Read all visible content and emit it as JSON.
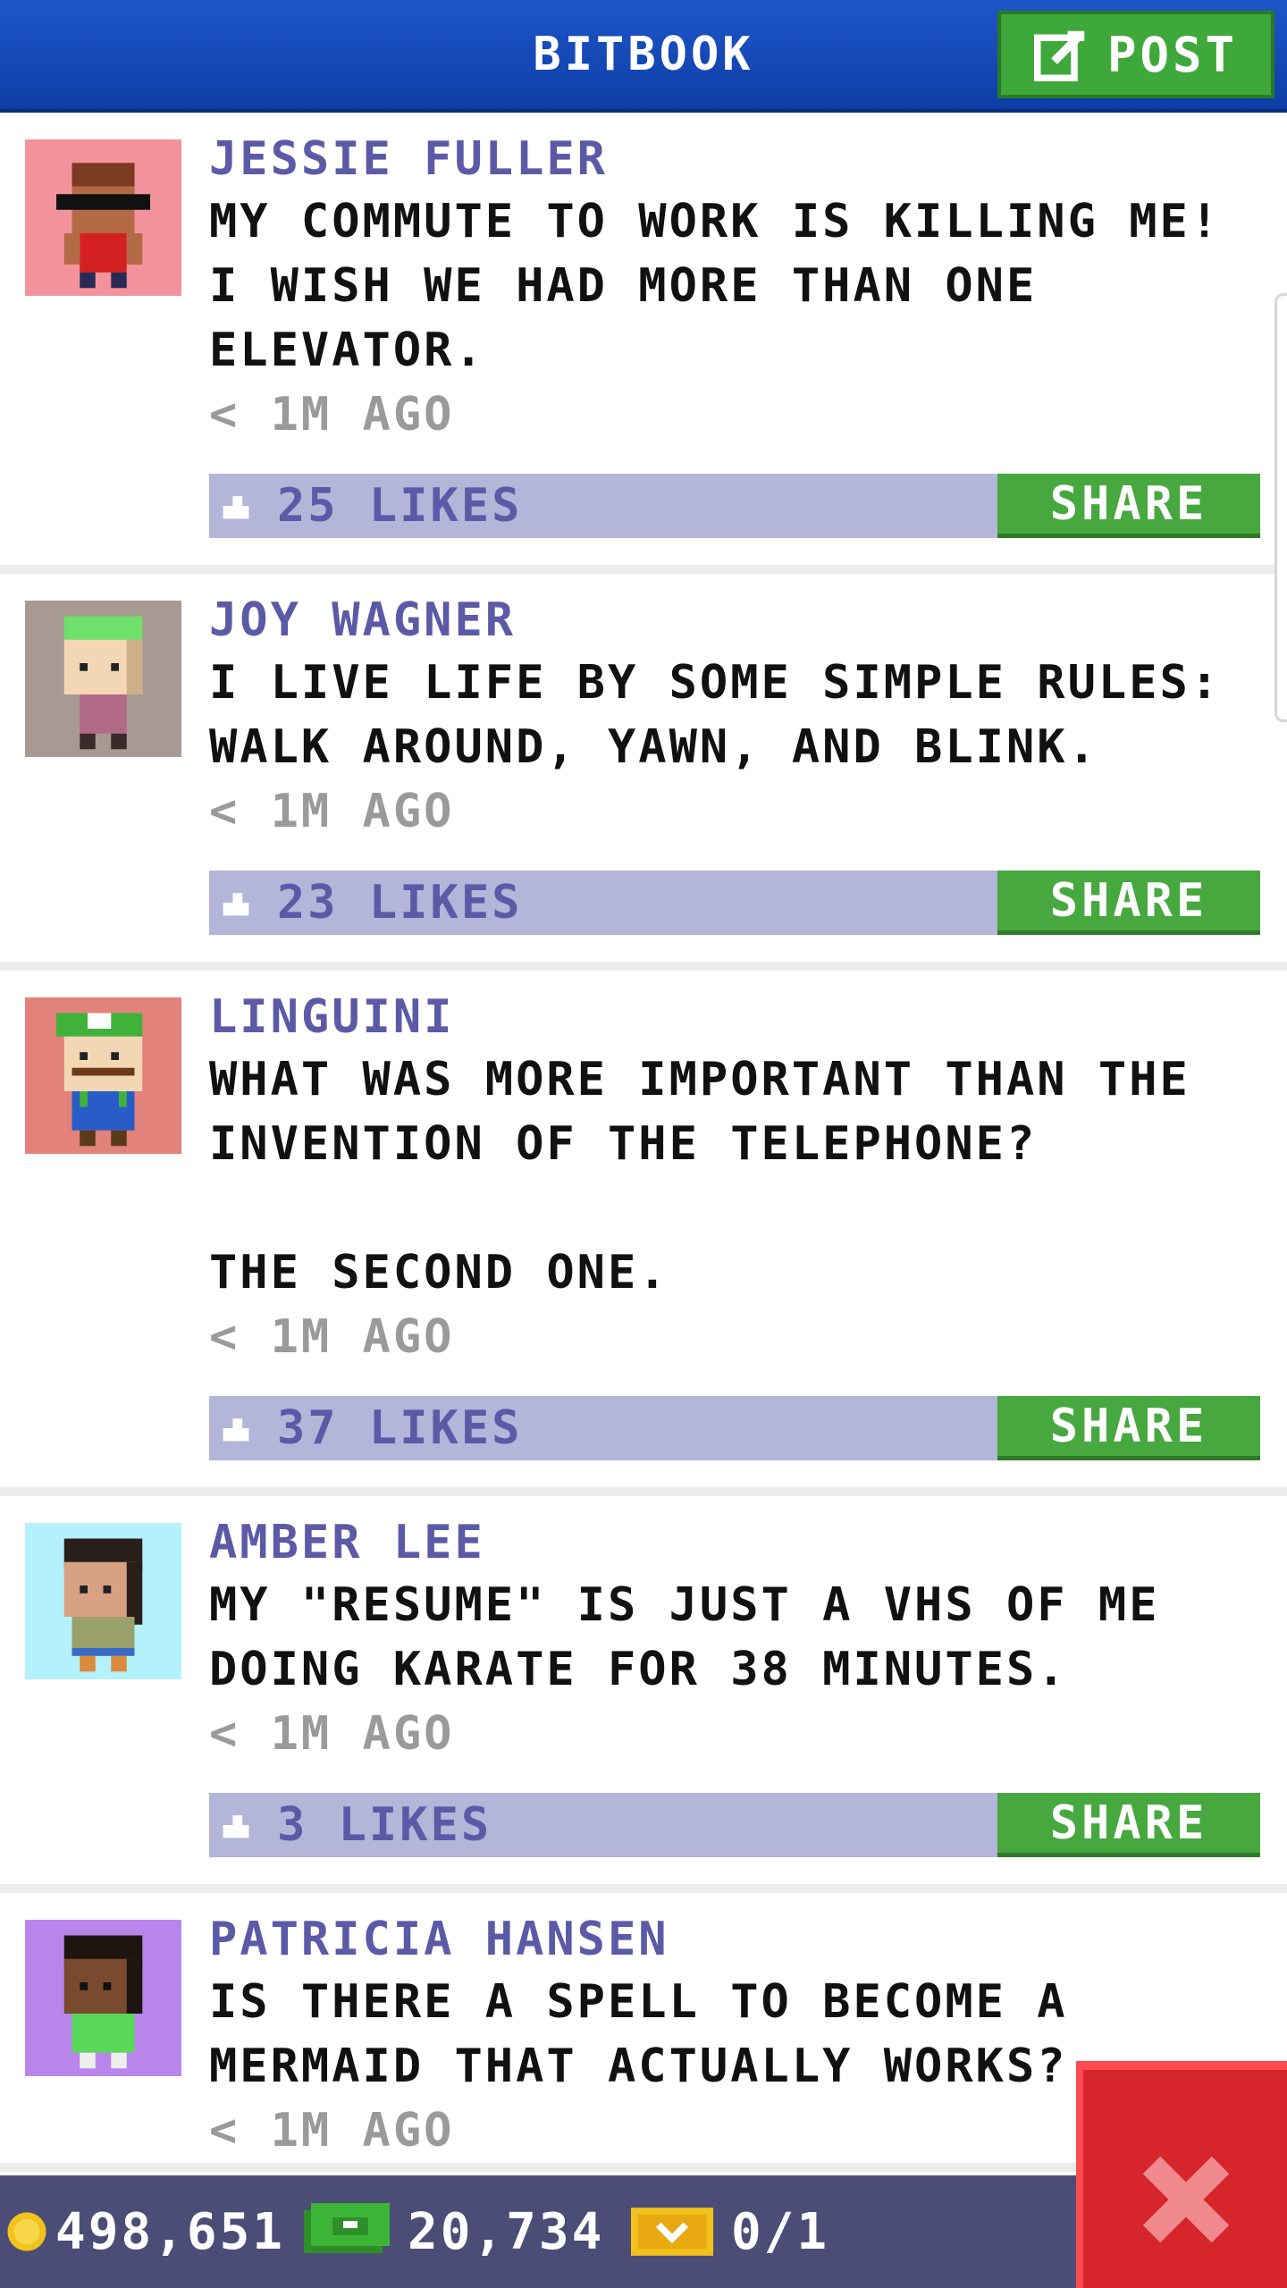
{
  "header": {
    "title": "BITBOOK",
    "post_label": "POST"
  },
  "posts": [
    {
      "author": "JESSIE FULLER",
      "text": "MY COMMUTE TO WORK IS KILLING ME! I WISH WE HAD MORE THAN ONE ELEVATOR.",
      "time": "< 1M AGO",
      "likes": "25 LIKES",
      "share": "SHARE",
      "avatar_bg": "#f2939b"
    },
    {
      "author": "JOY WAGNER",
      "text": "I LIVE LIFE BY SOME SIMPLE RULES: WALK AROUND, YAWN, AND BLINK.",
      "time": "< 1M AGO",
      "likes": "23 LIKES",
      "share": "SHARE",
      "avatar_bg": "#a89a92"
    },
    {
      "author": "LINGUINI",
      "text": "WHAT WAS MORE IMPORTANT THAN THE INVENTION OF THE TELEPHONE?\n\nTHE SECOND ONE.",
      "time": "< 1M AGO",
      "likes": "37 LIKES",
      "share": "SHARE",
      "avatar_bg": "#e2827b"
    },
    {
      "author": "AMBER LEE",
      "text": "MY \"RESUME\" IS JUST A VHS OF ME DOING KARATE FOR 38 MINUTES.",
      "time": "< 1M AGO",
      "likes": "3 LIKES",
      "share": "SHARE",
      "avatar_bg": "#b3f1fb"
    },
    {
      "author": "PATRICIA HANSEN",
      "text": "IS THERE A SPELL TO BECOME A MERMAID THAT ACTUALLY WORKS?",
      "time": "< 1M AGO",
      "avatar_bg": "#b985ea"
    }
  ],
  "footer": {
    "coins": "498,651",
    "bux": "20,734",
    "tickets": "0/1"
  },
  "icons": {
    "post": "edit-icon",
    "like": "thumbs-up-icon",
    "coin": "coin-icon",
    "bux": "bux-icon",
    "ticket": "golden-ticket-icon",
    "close": "close-icon"
  },
  "colors": {
    "header": "#1e56c8",
    "accent_green": "#46a83e",
    "likes_bar": "#b3b5d9",
    "author": "#5c5aa6",
    "footer": "#4b4d77",
    "close": "#d6252b"
  }
}
